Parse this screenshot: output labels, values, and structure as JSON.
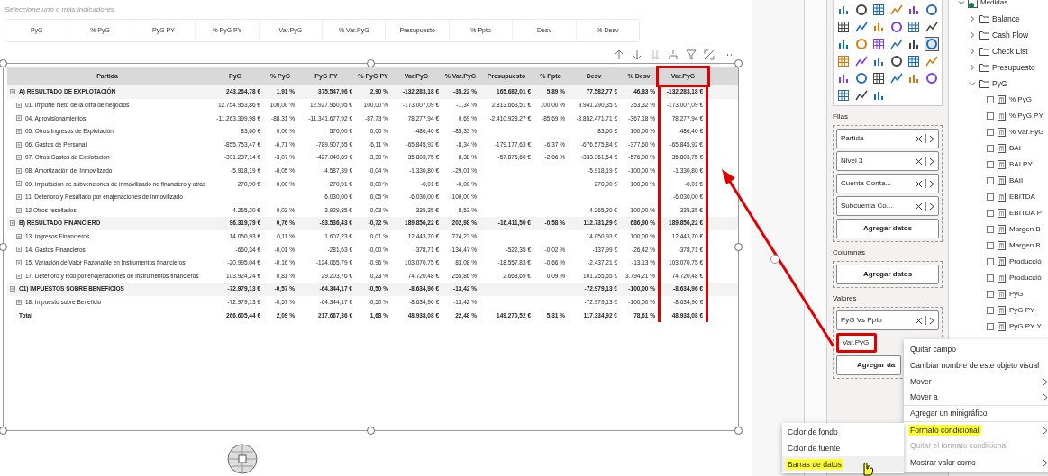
{
  "slicer": {
    "caption": "Seleccione uno o más indicadores",
    "options": [
      {
        "label": "PyG",
        "selected": false
      },
      {
        "label": "% PyG",
        "selected": false
      },
      {
        "label": "PyG PY",
        "selected": false
      },
      {
        "label": "% PyG PY",
        "selected": false
      },
      {
        "label": "Var.PyG",
        "selected": false
      },
      {
        "label": "% Var.PyG",
        "selected": false
      },
      {
        "label": "Presupuesto",
        "selected": false
      },
      {
        "label": "% Ppto",
        "selected": false
      },
      {
        "label": "Desv",
        "selected": false
      },
      {
        "label": "% Desv",
        "selected": false
      }
    ]
  },
  "table": {
    "columns": [
      {
        "label": "Partida",
        "highlighted": false
      },
      {
        "label": "PyG",
        "highlighted": false
      },
      {
        "label": "% PyG",
        "highlighted": false
      },
      {
        "label": "PyG PY",
        "highlighted": false
      },
      {
        "label": "% PyG PY",
        "highlighted": false
      },
      {
        "label": "Var.PyG",
        "highlighted": false
      },
      {
        "label": "% Var.PyG",
        "highlighted": false
      },
      {
        "label": "Presupuesto",
        "highlighted": false
      },
      {
        "label": "% Ppto",
        "highlighted": false
      },
      {
        "label": "Desv",
        "highlighted": false
      },
      {
        "label": "% Desv",
        "highlighted": false
      },
      {
        "label": "Var.PyG",
        "highlighted": true
      }
    ],
    "rows": [
      {
        "kind": "section",
        "cells": [
          "A) RESULTADO DE EXPLOTACIÓN",
          "243.264,78 €",
          "1,91 %",
          "375.547,96 €",
          "2,90 %",
          "-132.283,18 €",
          "-35,22 %",
          "165.682,01 €",
          "5,89 %",
          "77.582,77 €",
          "46,83 %",
          "-132.283,18 €"
        ]
      },
      {
        "kind": "item",
        "cells": [
          "01. Importe Neto de la cifra de negocios",
          "12.754.953,86 €",
          "100,00 %",
          "12.927.960,95 €",
          "100,00 %",
          "-173.007,09 €",
          "-1,34 %",
          "2.813.663,51 €",
          "100,00 %",
          "9.941.290,35 €",
          "353,32 %",
          "-173.007,09 €"
        ]
      },
      {
        "kind": "item",
        "cells": [
          "04. Aprovisionamientos",
          "-11.263.399,98 €",
          "-88,31 %",
          "-11.341.677,92 €",
          "-87,73 %",
          "78.277,94 €",
          "0,69 %",
          "-2.410.928,27 €",
          "-85,69 %",
          "-8.852.471,71 €",
          "-367,18 %",
          "78.277,94 €"
        ]
      },
      {
        "kind": "item",
        "cells": [
          "05. Otros Ingresos de Explotación",
          "83,60 €",
          "0,00 %",
          "570,00 €",
          "0,00 %",
          "-486,40 €",
          "-85,33 %",
          null,
          null,
          "83,60 €",
          "100,00 %",
          "-486,40 €"
        ]
      },
      {
        "kind": "item",
        "cells": [
          "06. Gastos de Personal",
          "-855.753,47 €",
          "-6,71 %",
          "-789.907,55 €",
          "-6,11 %",
          "-65.845,92 €",
          "-8,34 %",
          "-179.177,63 €",
          "-6,37 %",
          "-676.575,84 €",
          "-377,60 %",
          "-65.845,92 €"
        ]
      },
      {
        "kind": "item",
        "cells": [
          "07. Otros Gastos de Explotación",
          "-391.237,14 €",
          "-3,07 %",
          "-427.040,89 €",
          "-3,30 %",
          "35.803,75 €",
          "8,38 %",
          "-57.875,60 €",
          "-2,06 %",
          "-333.361,54 €",
          "-576,00 %",
          "35.803,75 €"
        ]
      },
      {
        "kind": "item",
        "cells": [
          "08. Amortización del Inmovilizado",
          "-5.918,19 €",
          "-0,05 %",
          "-4.587,39 €",
          "-0,04 %",
          "-1.330,80 €",
          "-29,01 %",
          null,
          null,
          "-5.918,19 €",
          "-100,00 %",
          "-1.330,80 €"
        ]
      },
      {
        "kind": "item",
        "cells": [
          "09. Imputación de subvenciones de inmovilizado no financiero y otras",
          "270,90 €",
          "0,00 %",
          "270,91 €",
          "0,00 %",
          "-0,01 €",
          "-0,00 %",
          null,
          null,
          "270,90 €",
          "100,00 %",
          "-0,01 €"
        ]
      },
      {
        "kind": "item",
        "cells": [
          "11. Deterioro y Resultado por enajenaciones de inmovilizado",
          null,
          null,
          "6.030,00 €",
          "0,05 %",
          "-6.030,00 €",
          "-100,00 %",
          null,
          null,
          null,
          null,
          "-6.030,00 €"
        ]
      },
      {
        "kind": "item",
        "cells": [
          "12 Otros resultados",
          "4.265,20 €",
          "0,03 %",
          "3.929,85 €",
          "0,03 %",
          "335,35 €",
          "8,53 %",
          null,
          null,
          "4.265,20 €",
          "100,00 %",
          "335,35 €"
        ]
      },
      {
        "kind": "section",
        "cells": [
          "B) RESULTADO FINANCIERO",
          "96.319,79 €",
          "0,76 %",
          "-93.536,43 €",
          "-0,72 %",
          "189.856,22 €",
          "202,98 %",
          "-16.411,50 €",
          "-0,58 %",
          "112.731,29 €",
          "686,90 %",
          "189.856,22 €"
        ]
      },
      {
        "kind": "item",
        "cells": [
          "13. Ingresos Financieros",
          "14.050,93 €",
          "0,11 %",
          "1.607,23 €",
          "0,01 %",
          "12.443,70 €",
          "774,23 %",
          null,
          null,
          "14.050,93 €",
          "100,00 %",
          "12.443,70 €"
        ]
      },
      {
        "kind": "item",
        "cells": [
          "14. Gastos Financieros",
          "-660,34 €",
          "-0,01 %",
          "-281,63 €",
          "-0,00 %",
          "-378,71 €",
          "-134,47 %",
          "-522,35 €",
          "-0,02 %",
          "-137,99 €",
          "-26,42 %",
          "-378,71 €"
        ]
      },
      {
        "kind": "item",
        "cells": [
          "15. Variación de Valor Razonable en Instrumentos financieros",
          "-20.995,04 €",
          "-0,16 %",
          "-124.065,79 €",
          "-0,96 %",
          "103.070,75 €",
          "83,08 %",
          "-18.557,83 €",
          "-0,66 %",
          "-2.437,21 €",
          "-13,13 %",
          "103.070,75 €"
        ]
      },
      {
        "kind": "item",
        "cells": [
          "17. Deterioro y Rdo por enajenaciones de instrumentos financieros",
          "103.924,24 €",
          "0,81 %",
          "29.203,76 €",
          "0,23 %",
          "74.720,48 €",
          "255,86 %",
          "2.668,69 €",
          "0,09 %",
          "101.255,55 €",
          "3.794,21 %",
          "74.720,48 €"
        ]
      },
      {
        "kind": "section",
        "cells": [
          "C1) IMPUESTOS SOBRE BENEFICIOS",
          "-72.979,13 €",
          "-0,57 %",
          "-64.344,17 €",
          "-0,50 %",
          "-8.634,96 €",
          "-13,42 %",
          null,
          null,
          "-72.979,13 €",
          "-100,00 %",
          "-8.634,96 €"
        ]
      },
      {
        "kind": "item",
        "cells": [
          "18. Impuesto sobre Beneficio",
          "-72.979,13 €",
          "-0,57 %",
          "-64.344,17 €",
          "-0,50 %",
          "-8.634,96 €",
          "-13,42 %",
          null,
          null,
          "-72.979,13 €",
          "-100,00 %",
          "-8.634,96 €"
        ]
      },
      {
        "kind": "total",
        "cells": [
          "Total",
          "266.605,44 €",
          "2,09 %",
          "217.667,36 €",
          "1,68 %",
          "48.938,08 €",
          "22,48 %",
          "149.270,52 €",
          "5,31 %",
          "117.334,92 €",
          "78,61 %",
          "48.938,08 €"
        ]
      }
    ]
  },
  "visualizations": [
    {
      "selected": false
    },
    {
      "selected": false
    },
    {
      "selected": false
    },
    {
      "selected": false
    },
    {
      "selected": false
    },
    {
      "selected": false
    },
    {
      "selected": false
    },
    {
      "selected": false
    },
    {
      "selected": false
    },
    {
      "selected": false
    },
    {
      "selected": false
    },
    {
      "selected": false
    },
    {
      "selected": false
    },
    {
      "selected": false
    },
    {
      "selected": false
    },
    {
      "selected": false
    },
    {
      "selected": false
    },
    {
      "selected": true
    },
    {
      "selected": false
    },
    {
      "selected": false
    },
    {
      "selected": false
    },
    {
      "selected": false
    },
    {
      "selected": false
    },
    {
      "selected": false
    },
    {
      "selected": false
    },
    {
      "selected": false
    },
    {
      "selected": false
    },
    {
      "selected": false
    },
    {
      "selected": false
    },
    {
      "selected": false
    },
    {
      "selected": false
    },
    {
      "selected": false
    },
    {
      "selected": false
    }
  ],
  "wells": [
    {
      "label": "Filas",
      "fields": [
        {
          "name": "Partida",
          "highlighted": false
        },
        {
          "name": "Nivel 3",
          "highlighted": false
        },
        {
          "name": "Cuenta Conta...",
          "highlighted": false
        },
        {
          "name": "Subcuenta Co...",
          "highlighted": false
        }
      ],
      "add": "Agregar datos"
    },
    {
      "label": "Columnas",
      "add": "Agregar datos"
    },
    {
      "label": "Valores",
      "fields": [
        {
          "name": "PyG Vs Ppto",
          "highlighted": false
        },
        {
          "name": "Var.PyG",
          "highlighted": true
        }
      ],
      "add": "Agregar da"
    }
  ],
  "fields_tree": {
    "name": "Medidas",
    "expanded": true,
    "children": [
      {
        "name": "Balance",
        "expanded": false
      },
      {
        "name": "Cash Flow",
        "expanded": false
      },
      {
        "name": "Check List",
        "expanded": false
      },
      {
        "name": "Presupuesto",
        "expanded": false
      },
      {
        "name": "PyG",
        "expanded": true,
        "children": [
          {
            "name": "% PyG",
            "checked": false
          },
          {
            "name": "% PyG PY",
            "checked": false
          },
          {
            "name": "% Var.PyG",
            "checked": false
          },
          {
            "name": "BAI",
            "checked": false
          },
          {
            "name": "BAI PY",
            "checked": false
          },
          {
            "name": "BAII",
            "checked": false
          },
          {
            "name": "EBITDA",
            "checked": false
          },
          {
            "name": "EBITDA P",
            "checked": false
          },
          {
            "name": "Margen B",
            "checked": false
          },
          {
            "name": "Margen B",
            "checked": false
          },
          {
            "name": "Producció",
            "checked": false
          },
          {
            "name": "Producció",
            "checked": false
          },
          {
            "name": "PyG",
            "checked": false
          },
          {
            "name": "PyG PY",
            "checked": false
          },
          {
            "name": "PyG PY Y",
            "checked": false
          }
        ]
      }
    ]
  },
  "context_menu": {
    "items": [
      {
        "label": "Quitar campo",
        "submenu": false,
        "disabled": false,
        "highlighted": false,
        "divider_after": false
      },
      {
        "label": "Cambiar nombre de este objeto visual",
        "submenu": false,
        "disabled": false,
        "highlighted": false,
        "divider_after": false
      },
      {
        "label": "Mover",
        "submenu": true,
        "disabled": false,
        "highlighted": false,
        "divider_after": false
      },
      {
        "label": "Mover a",
        "submenu": true,
        "disabled": false,
        "highlighted": false,
        "divider_after": true
      },
      {
        "label": "Agregar un minigráfico",
        "submenu": false,
        "disabled": false,
        "highlighted": false,
        "divider_after": true
      },
      {
        "label": "Formato condicional",
        "submenu": true,
        "disabled": false,
        "highlighted": true,
        "divider_after": false
      },
      {
        "label": "Quitar el formato condicional",
        "submenu": false,
        "disabled": true,
        "highlighted": false,
        "divider_after": true
      },
      {
        "label": "Mostrar valor como",
        "submenu": true,
        "disabled": false,
        "highlighted": false,
        "divider_after": false
      }
    ]
  },
  "submenu": {
    "items": [
      {
        "label": "Color de fondo",
        "highlighted": false
      },
      {
        "label": "Color de fuente",
        "highlighted": false
      },
      {
        "label": "Barras de datos",
        "highlighted": true
      }
    ]
  }
}
